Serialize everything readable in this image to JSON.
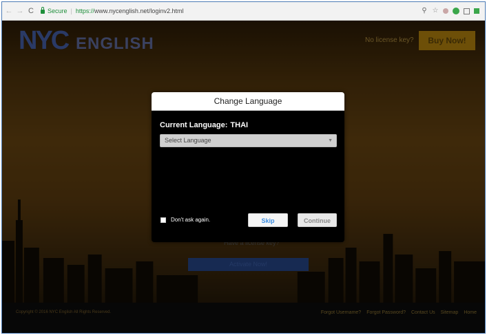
{
  "browser": {
    "secure_label": "Secure",
    "url_https": "https://",
    "url_rest": "www.nycenglish.net/loginv2.html",
    "icons": [
      "back-icon",
      "forward-icon",
      "reload-icon",
      "lock-icon",
      "pin-icon",
      "star-icon",
      "extension-icon",
      "extension-icon",
      "extension-icon",
      "extension-icon"
    ]
  },
  "page": {
    "logo_main": "NYC",
    "logo_sub": "ENGLISH",
    "license_question": "No license key?",
    "buy_now": "Buy Now!",
    "have_license": "Have a license key?",
    "activate": "Activate Now!",
    "copyright_line1": "Copyright © 2016 NYC English All Rights Reserved.",
    "copyright_line2": "",
    "footer_links": [
      "Forgot Username?",
      "Forgot Password?",
      "Contact Us",
      "Sitemap",
      "Home"
    ]
  },
  "modal": {
    "title": "Change Language",
    "current_language_label": "Current Language:",
    "current_language_value": "THAI",
    "select_placeholder": "Select Language",
    "dont_ask": "Don't ask again.",
    "skip": "Skip",
    "continue": "Continue"
  },
  "colors": {
    "modal_bg": "#000000",
    "skip_text": "#3c8de0",
    "secure_green": "#1e8f3b",
    "buy_now_bg": "#6d4f08"
  }
}
